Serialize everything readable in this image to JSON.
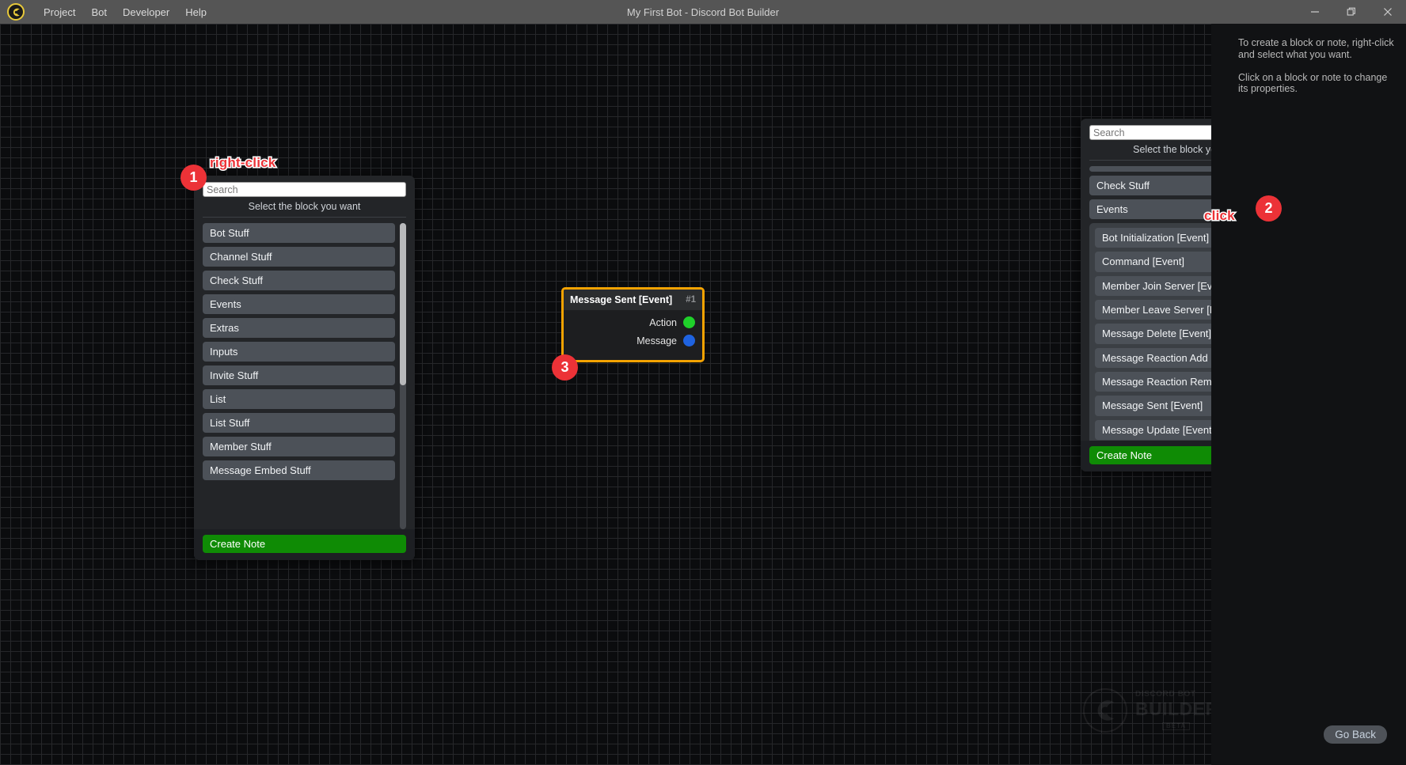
{
  "window": {
    "title": "My First Bot - Discord Bot Builder",
    "logo_icon": "wrench-circle-logo-icon",
    "menu": [
      {
        "label": "Project",
        "name": "menu-project"
      },
      {
        "label": "Bot",
        "name": "menu-bot"
      },
      {
        "label": "Developer",
        "name": "menu-developer"
      },
      {
        "label": "Help",
        "name": "menu-help"
      }
    ],
    "controls": {
      "minimize": "minimize-icon",
      "restore": "restore-icon",
      "close": "close-icon"
    }
  },
  "sidebar": {
    "help_lines": [
      "To create a block or note, right-click and select what you want.",
      "Click on a block or note to change its properties."
    ],
    "go_back_label": "Go Back"
  },
  "watermark": {
    "line1": "DISCORD BOT",
    "line2": "BUILDER",
    "badge": "BETA"
  },
  "block_node": {
    "title": "Message Sent [Event]",
    "number": "#1",
    "ports": [
      {
        "label": "Action",
        "color": "#1fd02a"
      },
      {
        "label": "Message",
        "color": "#1f63e0"
      }
    ],
    "border_color": "#f5a302"
  },
  "picker_left": {
    "search_placeholder": "Search",
    "search_value": "",
    "subtitle": "Select the block you want",
    "categories": [
      "Bot Stuff",
      "Channel Stuff",
      "Check Stuff",
      "Events",
      "Extras",
      "Inputs",
      "Invite Stuff",
      "List",
      "List Stuff",
      "Member Stuff",
      "Message Embed Stuff"
    ],
    "create_note_label": "Create Note"
  },
  "picker_right": {
    "search_placeholder": "Search",
    "search_value": "",
    "subtitle": "Select the block you want",
    "visible_category": "Check Stuff",
    "expanded_category": "Events",
    "expanded_items": [
      "Bot Initialization [Event]",
      "Command [Event]",
      "Member Join Server [Event]",
      "Member Leave Server [Event]",
      "Message Delete [Event]",
      "Message Reaction Add [Event]",
      "Message Reaction Remove [Event]",
      "Message Sent [Event]",
      "Message Update [Event]"
    ],
    "create_note_label": "Create Note"
  },
  "annotations": {
    "badge1": "1",
    "label1": "right-click",
    "badge2": "2",
    "label2": "click",
    "badge3": "3",
    "accent_color": "#ec3237"
  }
}
